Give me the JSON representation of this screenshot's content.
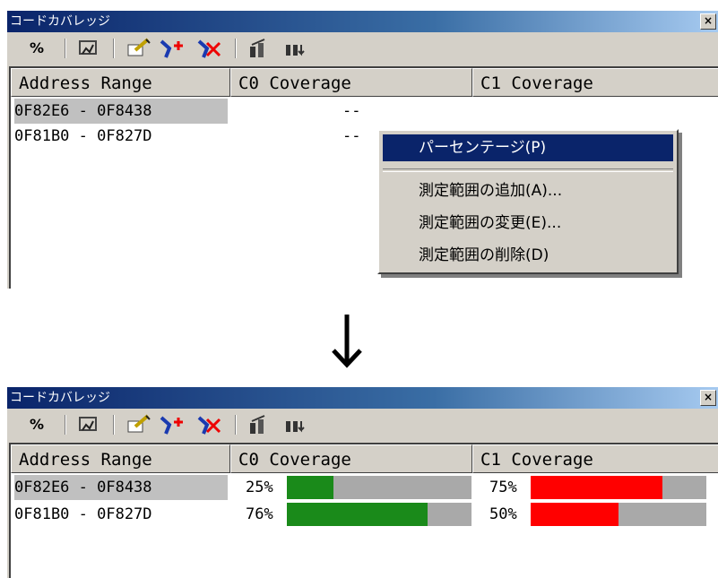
{
  "window_title": "コードカバレッジ",
  "close_glyph": "×",
  "toolbar": {
    "percent_label": "%",
    "icons": [
      "percent-icon",
      "coverage-icon",
      "edit-range-icon",
      "add-range-icon",
      "delete-range-icon",
      "go-to-icon",
      "search-icon"
    ]
  },
  "columns": [
    "Address Range",
    "C0 Coverage",
    "C1 Coverage"
  ],
  "before": {
    "rows": [
      {
        "range": "0F82E6 - 0F8438",
        "c0": "--"
      },
      {
        "range": "0F81B0 - 0F827D",
        "c0": "--"
      }
    ]
  },
  "context_menu": {
    "items": [
      "パーセンテージ(P)",
      "測定範囲の追加(A)...",
      "測定範囲の変更(E)...",
      "測定範囲の削除(D)"
    ]
  },
  "after": {
    "rows": [
      {
        "range": "0F82E6 - 0F8438",
        "c0": "25%",
        "c0_value": 0.25,
        "c1": "75%",
        "c1_value": 0.75
      },
      {
        "range": "0F81B0 - 0F827D",
        "c0": "76%",
        "c0_value": 0.76,
        "c1": "50%",
        "c1_value": 0.5
      }
    ]
  },
  "colors": {
    "c0_fill": "#1a8a1a",
    "c1_fill": "#ff0000",
    "bar_bg": "#a9a9a9"
  }
}
